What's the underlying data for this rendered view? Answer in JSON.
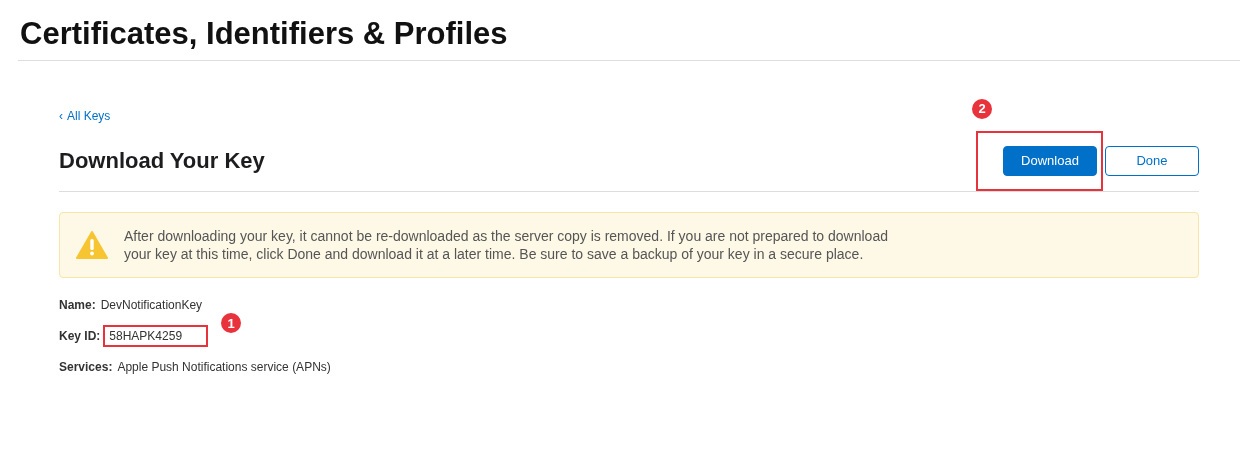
{
  "page_title": "Certificates, Identifiers & Profiles",
  "back_link": {
    "icon": "‹",
    "label": "All Keys"
  },
  "heading": "Download Your Key",
  "buttons": [
    {
      "label": "Download",
      "kind": "primary",
      "annotation": "2"
    },
    {
      "label": "Done",
      "kind": "secondary"
    }
  ],
  "warning": "After downloading your key, it cannot be re-downloaded as the server copy is removed. If you are not prepared to download your key at this time, click Done and download it at a later time. Be sure to save a backup of your key in a secure place.",
  "details": [
    {
      "label": "Name:",
      "value": "DevNotificationKey"
    },
    {
      "label": "Key ID:",
      "value": "58HAPK4259",
      "annotation": "1"
    },
    {
      "label": "Services:",
      "value": "Apple Push Notifications service (APNs)"
    }
  ]
}
